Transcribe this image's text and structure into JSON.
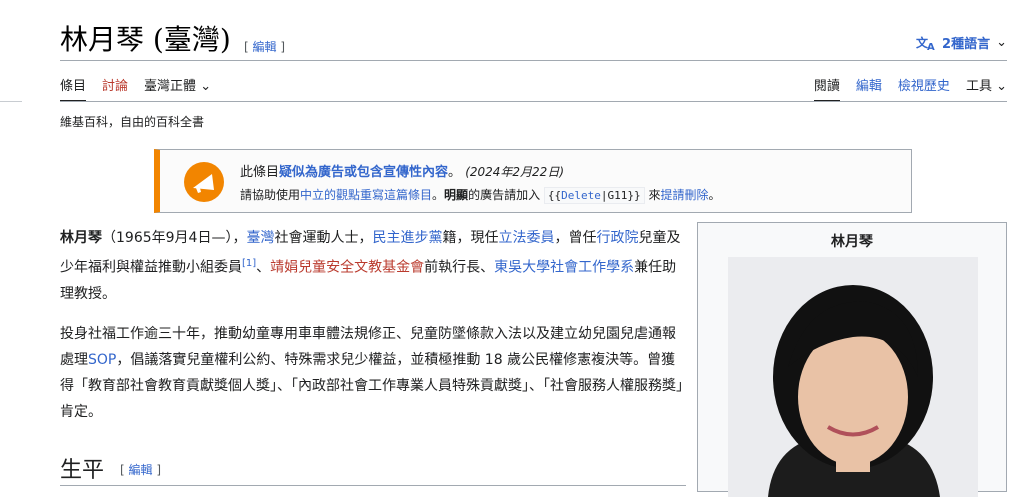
{
  "title": "林月琴 (臺灣)",
  "edit_label": "編輯",
  "languages": "2種語言",
  "tabs_left": [
    "條目",
    "討論",
    "臺灣正體"
  ],
  "tabs_right": [
    "閱讀",
    "編輯",
    "檢視歷史",
    "工具"
  ],
  "tagline": "維基百科，自由的百科全書",
  "ambox": {
    "line1_pre": "此條目",
    "line1_bold": "疑似為廣告或包含宣傳性內容",
    "line1_post": "。",
    "date": "(2024年2月22日)",
    "line2_pre": "請協助使用",
    "line2_link": "中立的觀點重寫這篇條目",
    "line2_mid1": "。",
    "line2_bold": "明顯",
    "line2_mid2": "的廣告請加入",
    "template_open": "{{",
    "template_name": "Delete",
    "template_sep": "|",
    "template_arg": "G11",
    "template_close": "}}",
    "line2_mid3": "來",
    "line2_link2": "提請刪除",
    "line2_end": "。"
  },
  "para1": {
    "name": "林月琴",
    "dates": "（1965年9月4日—），",
    "l1": "臺灣",
    "t1": "社會運動人士，",
    "l2": "民主進步黨",
    "t2": "籍，現任",
    "l3": "立法委員",
    "t3": "，曾任",
    "l4": "行政院",
    "t4": "兒童及少年福利與權益推動小組委員",
    "ref": "[1]",
    "t5": "、",
    "l5": "靖娟兒童安全文教基金會",
    "t6": "前執行長、",
    "l6": "東吳大學社會工作學系",
    "t7": "兼任助理教授。"
  },
  "para2": {
    "t1": "投身社福工作逾三十年，推動幼童專用車車體法規修正、兒童防墜條款入法以及建立幼兒園兒虐通報處理",
    "l1": "SOP",
    "t2": "，倡議落實兒童權利公約、特殊需求兒少權益，並積極推動 18 歲公民權修憲複決等。曾獲得「教育部社會教育貢獻獎個人獎」、「內政部社會工作專業人員特殊貢獻獎」、「社會服務人權服務獎」肯定。"
  },
  "infobox_title": "林月琴",
  "section_heading": "生平",
  "colors": {
    "link": "#3366cc",
    "redlink": "#ba3a2d",
    "ambox_accent": "#f28500"
  }
}
